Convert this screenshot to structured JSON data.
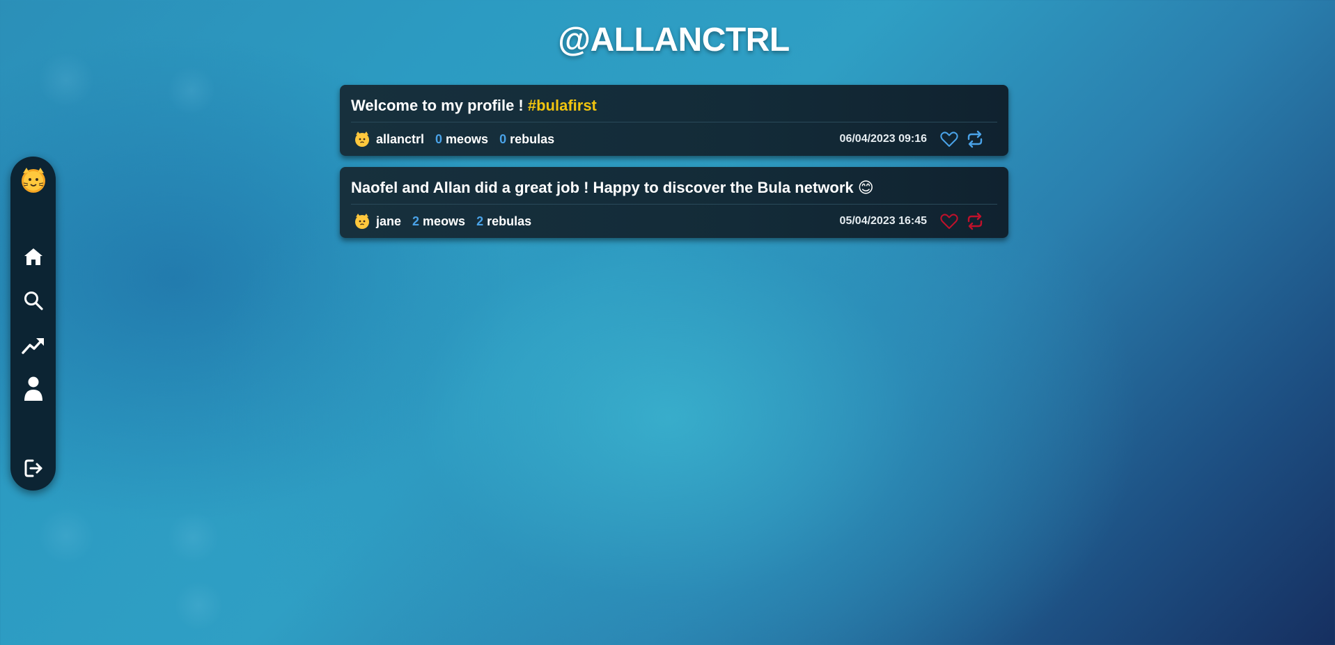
{
  "profile": {
    "title": "@ALLANCTRL"
  },
  "sidebar": {
    "items": [
      {
        "name": "home",
        "icon": "home-icon"
      },
      {
        "name": "search",
        "icon": "search-icon"
      },
      {
        "name": "trending",
        "icon": "trending-up-icon"
      },
      {
        "name": "profile",
        "icon": "user-icon"
      },
      {
        "name": "logout",
        "icon": "logout-icon"
      }
    ],
    "logo_icon": "cat-face-icon"
  },
  "posts": [
    {
      "text": "Welcome to my profile ! ",
      "hashtag": "#bulafirst",
      "author": "allanctrl",
      "meows_count": "0",
      "meows_label": "meows",
      "rebulas_count": "0",
      "rebulas_label": "rebulas",
      "date": "06/04/2023 09:16",
      "action_color": "#4aa3e8"
    },
    {
      "text": "Naofel and Allan did a great job ! Happy to discover the Bula network ",
      "emoji": "😊",
      "author": "jane",
      "meows_count": "2",
      "meows_label": "meows",
      "rebulas_count": "2",
      "rebulas_label": "rebulas",
      "date": "05/04/2023 16:45",
      "action_color": "#c0112b"
    }
  ],
  "colors": {
    "accent": "#4aa3e8",
    "hashtag": "#f1c40f",
    "liked": "#c0112b",
    "card": "#132b38",
    "sidebar": "#0c2433"
  }
}
